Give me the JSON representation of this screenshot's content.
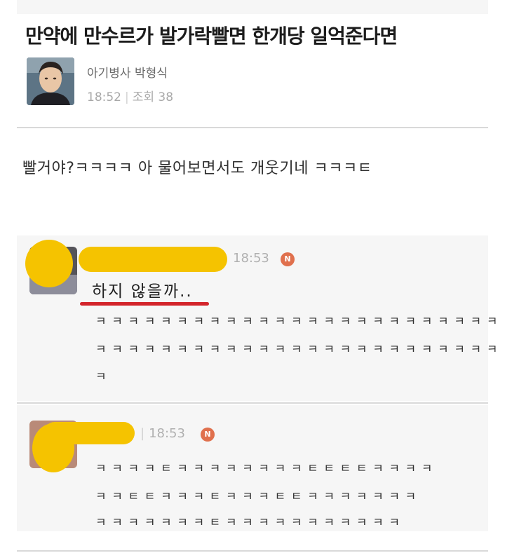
{
  "post": {
    "title": "만약에 만수르가 발가락빨면 한개당 일억준다면",
    "author": "아기병사 박형식",
    "time": "18:52",
    "views_label": "조회 38",
    "body": "빨거야?ㅋㅋㅋㅋ 아 물어보면서도 개웃기네 ㅋㅋㅋㅌ"
  },
  "comments": [
    {
      "time": "18:53",
      "badge": "N",
      "lines": [
        "하지 않을까..",
        "ㅋㅋㅋㅋㅋㅋㅋㅋㅋㅋㅋㅋㅋㅋㅋㅋㅋㅋㅋㅋㅋㅋㅋㅋㅋ",
        "ㅋㅋㅋㅋㅋㅋㅋㅋㅋㅋㅋㅋㅋㅋㅋㅋㅋㅋㅋㅋㅋㅋㅋㅋㅋ",
        "ㅋ"
      ]
    },
    {
      "time": "18:53",
      "badge": "N",
      "lines": [
        "ㅋㅋㅋㅋㅌㅋㅋㅋㅋㅋㅋㅋㅋㅌㅌㅌㅌㅋㅋㅋㅋ",
        "ㅋㅋㅌㅌㅋㅋㅋㅌㅋㅋㅋㅌㅌㅋㅋㅋㅋㅋㅋㅋ",
        "ㅋㅋㅋㅋㅋㅋㅋㅌㅋㅋㅋㅋㅋㅋㅋㅋㅋㅋㅋ"
      ]
    }
  ],
  "colors": {
    "redaction": "#f5c300",
    "badge": "#e0704d",
    "underline": "#d3242b"
  }
}
